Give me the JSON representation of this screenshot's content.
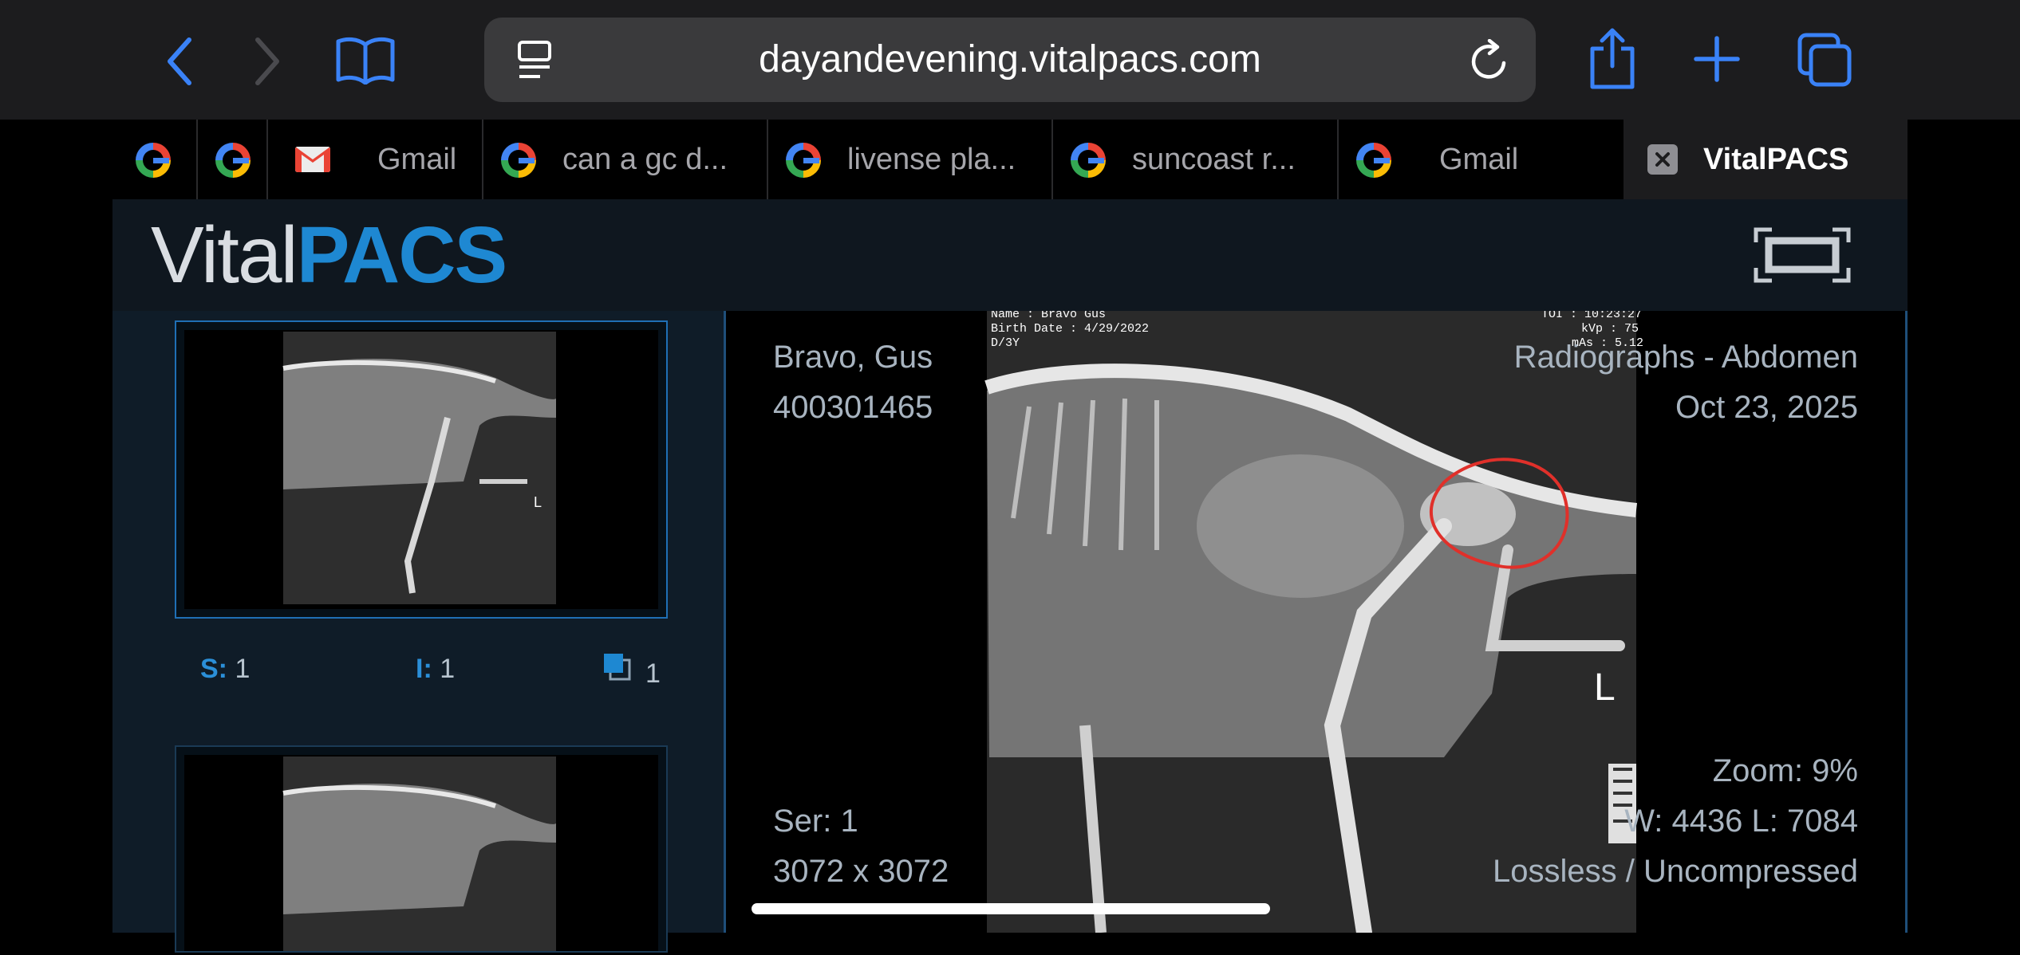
{
  "browser": {
    "url": "dayandevening.vitalpacs.com",
    "icons": [
      "back-chevron-icon",
      "forward-chevron-icon",
      "bookmarks-book-icon",
      "reader-mode-icon",
      "reload-icon",
      "share-icon",
      "new-tab-plus-icon",
      "tabs-overview-icon"
    ],
    "accent": "#3a82f7"
  },
  "tabs": [
    {
      "label": "",
      "icon": "google-icon"
    },
    {
      "label": "",
      "icon": "google-icon"
    },
    {
      "label": "Gmail",
      "icon": "gmail-icon"
    },
    {
      "label": "can a gc d...",
      "icon": "google-icon"
    },
    {
      "label": "livense pla...",
      "icon": "google-icon"
    },
    {
      "label": "suncoast r...",
      "icon": "google-icon"
    },
    {
      "label": "Gmail",
      "icon": "google-icon"
    },
    {
      "label": "VitalPACS",
      "icon": "close-icon",
      "active": true
    }
  ],
  "app": {
    "logo_vital": "Vital",
    "logo_pacs": "PACS",
    "brand_color": "#1e88d2",
    "fullscreen_icon": "fullscreen-icon"
  },
  "thumbnails": {
    "meta": {
      "s_label": "S:",
      "s_value": "1",
      "i_label": "I:",
      "i_value": "1",
      "stack_value": "1"
    }
  },
  "viewer": {
    "patient_name": "Bravo, Gus",
    "patient_id": "400301465",
    "study": "Radiographs - Abdomen",
    "date": "Oct 23, 2025",
    "series": "Ser: 1",
    "dimensions": "3072 x 3072",
    "zoom": "Zoom: 9%",
    "window_level": "W: 4436 L: 7084",
    "compression": "Lossless / Uncompressed",
    "marker": "L",
    "annotation_color": "#e0302a",
    "image_header": {
      "name": "Name : Bravo Gus",
      "birth": "Birth Date : 4/29/2022",
      "age": "D/3Y",
      "time": "TOI : 10:23:27",
      "kvp": "kVp : 75",
      "mas": "mAs : 5.12"
    }
  }
}
